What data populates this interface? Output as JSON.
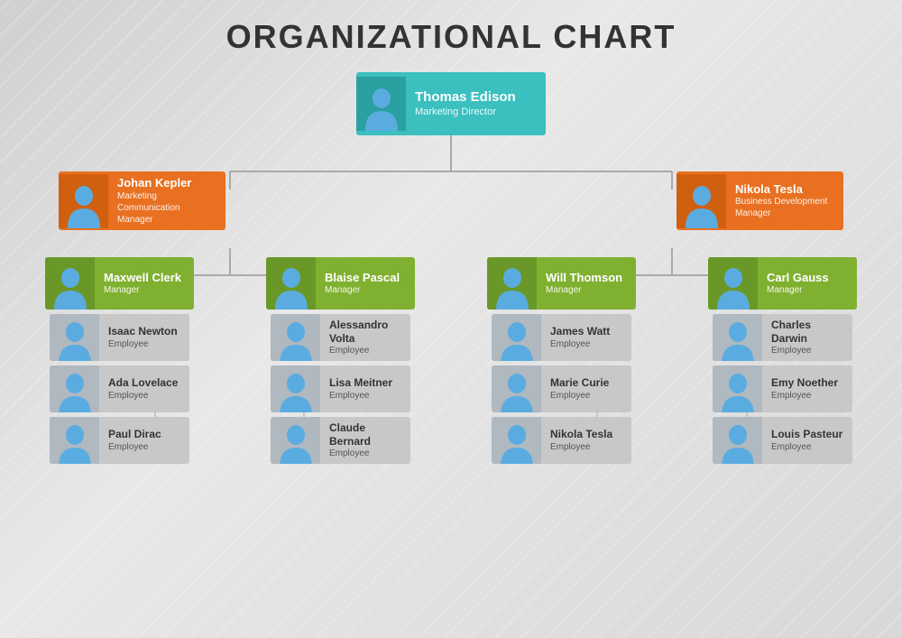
{
  "title": "ORGANIZATIONAL CHART",
  "nodes": {
    "top": {
      "name": "Thomas Edison",
      "role": "Marketing Director",
      "level": "top"
    },
    "l1_left": {
      "name": "Johan Kepler",
      "role": "Marketing Communication Manager",
      "level": "mgr1"
    },
    "l1_right": {
      "name": "Nikola Tesla",
      "role": "Business Development Manager",
      "level": "mgr1"
    },
    "l2_1": {
      "name": "Maxwell Clerk",
      "role": "Manager",
      "level": "mgr2"
    },
    "l2_2": {
      "name": "Blaise Pascal",
      "role": "Manager",
      "level": "mgr2"
    },
    "l2_3": {
      "name": "Will Thomson",
      "role": "Manager",
      "level": "mgr2"
    },
    "l2_4": {
      "name": "Carl Gauss",
      "role": "Manager",
      "level": "mgr2"
    },
    "emp_1_1": {
      "name": "Isaac Newton",
      "role": "Employee"
    },
    "emp_1_2": {
      "name": "Ada Lovelace",
      "role": "Employee"
    },
    "emp_1_3": {
      "name": "Paul Dirac",
      "role": "Employee"
    },
    "emp_2_1": {
      "name": "Alessandro Volta",
      "role": "Employee"
    },
    "emp_2_2": {
      "name": "Lisa Meitner",
      "role": "Employee"
    },
    "emp_2_3": {
      "name": "Claude Bernard",
      "role": "Employee"
    },
    "emp_3_1": {
      "name": "James Watt",
      "role": "Employee"
    },
    "emp_3_2": {
      "name": "Marie Curie",
      "role": "Employee"
    },
    "emp_3_3": {
      "name": "Nikola Tesla",
      "role": "Employee"
    },
    "emp_4_1": {
      "name": "Charles Darwin",
      "role": "Employee"
    },
    "emp_4_2": {
      "name": "Emy Noether",
      "role": "Employee"
    },
    "emp_4_3": {
      "name": "Louis Pasteur",
      "role": "Employee"
    }
  }
}
